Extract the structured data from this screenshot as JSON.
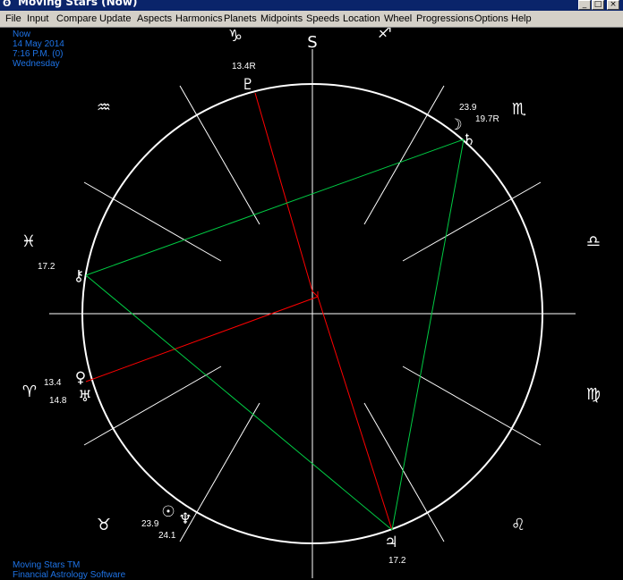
{
  "window": {
    "title": "Moving Stars (Now)",
    "buttons": {
      "minimize": "_",
      "maximize": "□",
      "close": "×"
    }
  },
  "menu": [
    "File",
    "Input",
    "Compare",
    "Update",
    "Aspects",
    "Harmonics",
    "Planets",
    "Midpoints",
    "Speeds",
    "Location",
    "Wheel",
    "Progressions",
    "Options",
    "Help"
  ],
  "chart_info": {
    "name": "Now",
    "date": "14 May 2014",
    "time": "7:16 P.M. (0)",
    "weekday": "Wednesday"
  },
  "footer": {
    "product": "Moving Stars TM",
    "tagline": "Financial Astrology Software"
  },
  "wheel": {
    "top_label": "S",
    "signs": [
      {
        "name": "capricorn",
        "glyph": "♑"
      },
      {
        "name": "sagittarius",
        "glyph": "♐"
      },
      {
        "name": "scorpio",
        "glyph": "♏"
      },
      {
        "name": "libra",
        "glyph": "♎"
      },
      {
        "name": "virgo",
        "glyph": "♍"
      },
      {
        "name": "leo",
        "glyph": "♌"
      },
      {
        "name": "taurus",
        "glyph": "♉"
      },
      {
        "name": "aries",
        "glyph": "♈"
      },
      {
        "name": "pisces",
        "glyph": "♓"
      },
      {
        "name": "aquarius",
        "glyph": "♒"
      }
    ],
    "planets": [
      {
        "name": "pluto",
        "glyph": "♇",
        "degree": "13.4R"
      },
      {
        "name": "moon",
        "glyph": "☽",
        "degree": "23.9"
      },
      {
        "name": "saturn",
        "glyph": "♄",
        "degree": "19.7R"
      },
      {
        "name": "chiron",
        "glyph": "⚷",
        "degree": "17.2"
      },
      {
        "name": "venus",
        "glyph": "♀",
        "degree": "13.4"
      },
      {
        "name": "uranus",
        "glyph": "♅",
        "degree": "14.8"
      },
      {
        "name": "sun",
        "glyph": "☉",
        "degree": "23.9"
      },
      {
        "name": "neptune",
        "glyph": "♆",
        "degree": "24.1"
      },
      {
        "name": "jupiter",
        "glyph": "♃",
        "degree": "17.2"
      }
    ],
    "colors": {
      "circle": "#ffffff",
      "axis": "#ffffff",
      "aspect_red": "#ff0000",
      "aspect_green": "#00cc44"
    }
  }
}
